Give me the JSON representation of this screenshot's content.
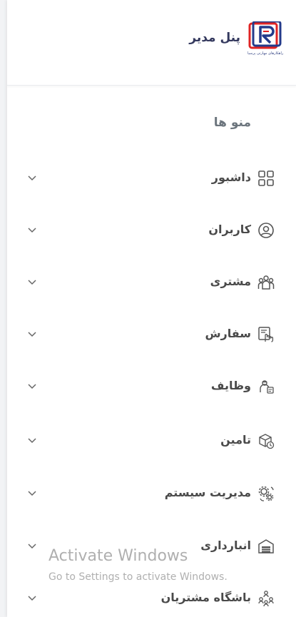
{
  "brand": {
    "title": "پنل مدیر",
    "logo_caption": "راهکارهای مهارتی پرسیا",
    "logo_colors": {
      "frame": "#233a8a",
      "accent": "#e02424"
    }
  },
  "menu": {
    "heading": "منو ها",
    "items": [
      {
        "label": "داشبور",
        "icon": "dashboard-grid-icon"
      },
      {
        "label": "کاربران",
        "icon": "user-circle-icon"
      },
      {
        "label": "مشتری",
        "icon": "customers-group-icon"
      },
      {
        "label": "سفارش",
        "icon": "order-hand-icon"
      },
      {
        "label": "وظایف",
        "icon": "tasks-worker-icon"
      },
      {
        "label": "تامین",
        "icon": "supply-box-icon"
      },
      {
        "label": "مدیریت سیستم",
        "icon": "system-gears-icon"
      },
      {
        "label": "انبارداری",
        "icon": "warehouse-icon"
      },
      {
        "label": "باشگاه مشتریان",
        "icon": "customer-club-icon"
      }
    ]
  },
  "watermark": {
    "title": "Activate Windows",
    "subtitle": "Go to Settings to activate Windows."
  }
}
